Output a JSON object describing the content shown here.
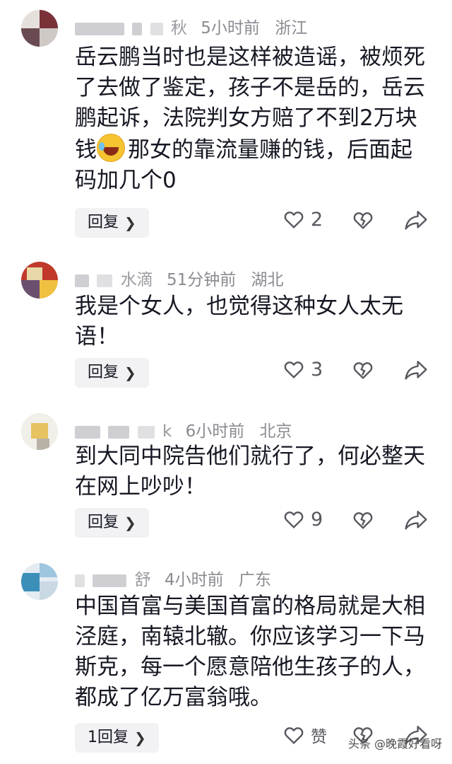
{
  "comments": [
    {
      "username_fragment": "秋",
      "time": "5小时前",
      "location": "浙江",
      "text_part1": "岳云鹏当时也是这样被造谣，被烦死了去做了鉴定，孩子不是岳的，岳云鹏起诉，法院判女方赔了不到2万块钱",
      "emoji": "crying-laughing-emoji",
      "text_part2": "那女的靠流量赚的钱，后面起码加几个0",
      "reply_label": "回复",
      "like_count": "2"
    },
    {
      "username_fragment": "水滴",
      "time": "51分钟前",
      "location": "湖北",
      "text": "我是个女人，也觉得这种女人太无语！",
      "reply_label": "回复",
      "like_count": "3"
    },
    {
      "username_fragment": "k",
      "time": "6小时前",
      "location": "北京",
      "text": "到大同中院告他们就行了，何必整天在网上吵吵！",
      "reply_label": "回复",
      "like_count": "9"
    },
    {
      "username_fragment": "舒",
      "time": "4小时前",
      "location": "广东",
      "text": "中国首富与美国首富的格局就是大相泾庭，南辕北辙。你应该学习一下马斯克，每一个愿意陪他生孩子的人，都成了亿万富翁哦。",
      "reply_label": "1回复",
      "like_count": "赞"
    }
  ],
  "watermark": "头条 @晚霞好看呀",
  "icons": {
    "like": "heart-outline-icon",
    "dislike": "broken-heart-icon",
    "share": "share-arrow-icon",
    "chevron": "chevron-right-icon"
  }
}
